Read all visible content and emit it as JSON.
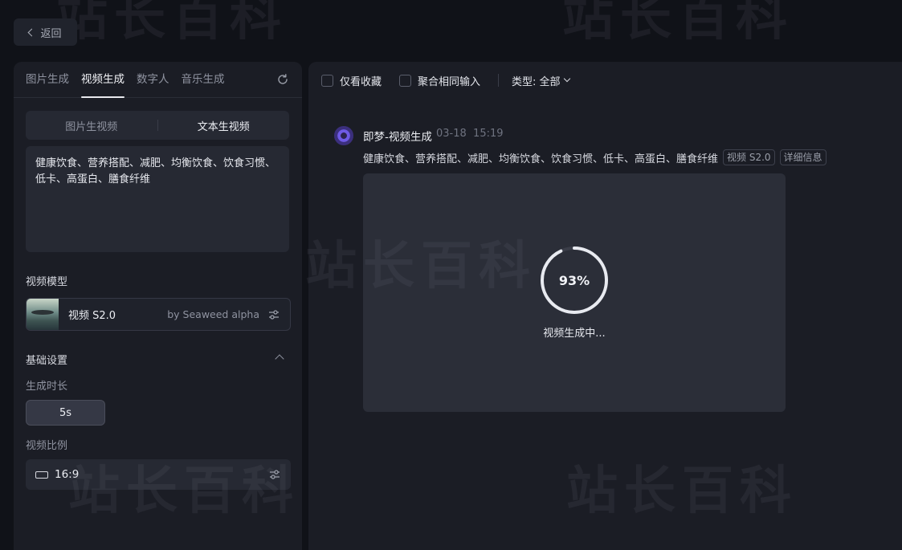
{
  "nav": {
    "back_label": "返回"
  },
  "left": {
    "tabs": [
      {
        "label": "图片生成",
        "active": false
      },
      {
        "label": "视频生成",
        "active": true
      },
      {
        "label": "数字人",
        "active": false
      },
      {
        "label": "音乐生成",
        "active": false
      }
    ],
    "segment": [
      {
        "label": "图片生视频",
        "active": false
      },
      {
        "label": "文本生视频",
        "active": true
      }
    ],
    "prompt_text": "健康饮食、营养搭配、减肥、均衡饮食、饮食习惯、低卡、高蛋白、膳食纤维",
    "model_section_label": "视频模型",
    "model": {
      "name": "视频 S2.0",
      "by": "by Seaweed alpha"
    },
    "basic_settings_label": "基础设置",
    "duration_label": "生成时长",
    "duration_value": "5s",
    "ratio_label": "视频比例",
    "ratio_value": "16:9"
  },
  "right": {
    "toolbar": {
      "favorites_only": "仅看收藏",
      "merge_same_input": "聚合相同输入",
      "type_filter": "类型: 全部"
    },
    "generation": {
      "title": "即梦-视频生成",
      "date": "03-18",
      "time": "15:19",
      "prompt": "健康饮食、营养搭配、减肥、均衡饮食、饮食习惯、低卡、高蛋白、膳食纤维",
      "model_tag": "视频 S2.0",
      "details_tag": "详细信息",
      "progress_percent": 93,
      "progress_label": "93%",
      "status_text": "视频生成中..."
    }
  },
  "watermark_text": "站长百科",
  "colors": {
    "accent_ring": "#e8eaf0",
    "panel_bg": "#1b1d25",
    "page_bg": "#101218"
  }
}
